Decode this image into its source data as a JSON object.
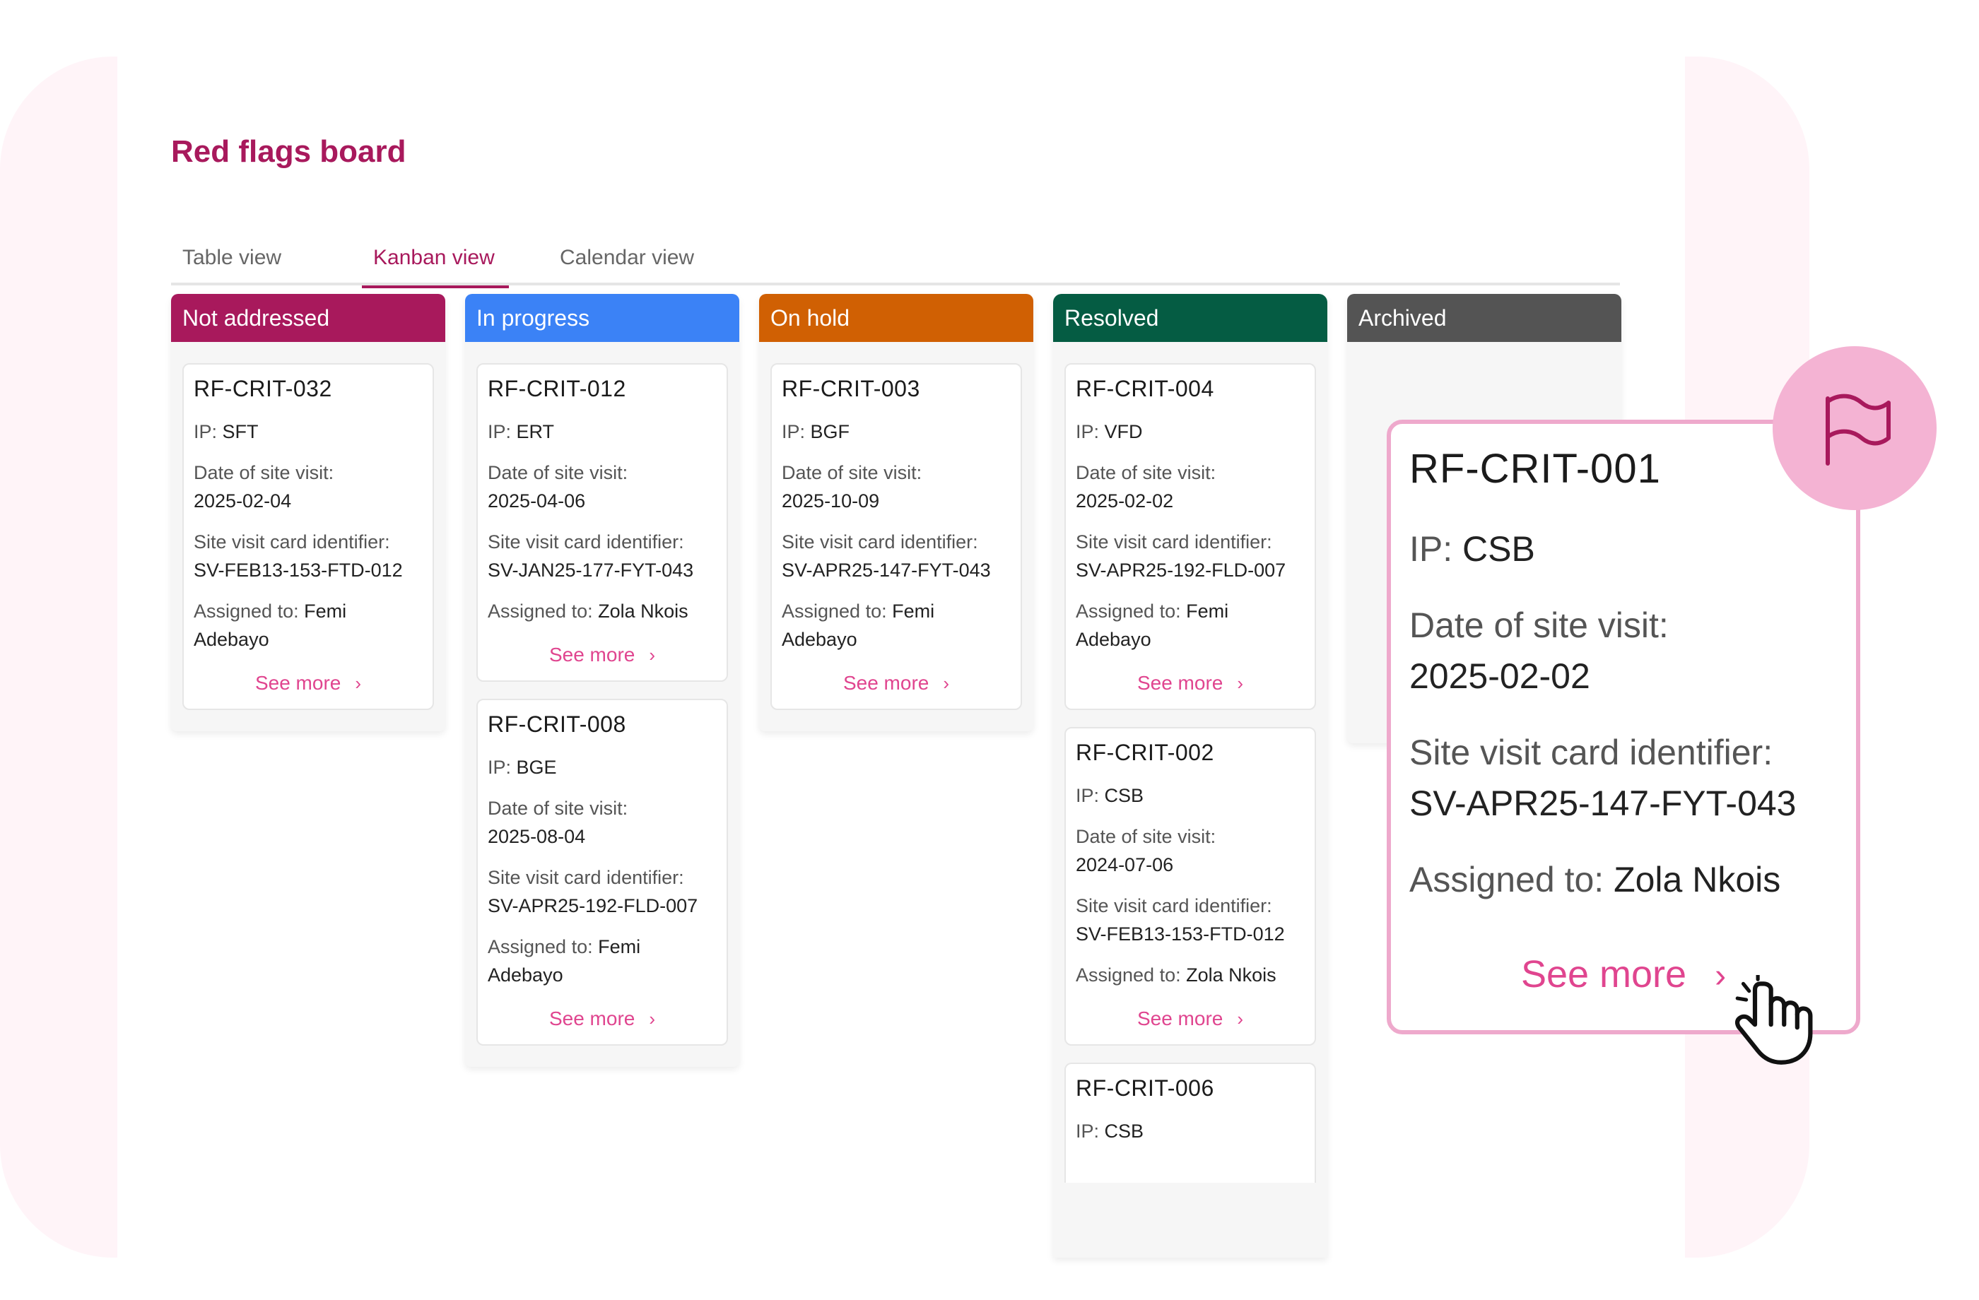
{
  "page_title": "Red flags board",
  "tabs": [
    {
      "label": "Table view",
      "active": false
    },
    {
      "label": "Kanban view",
      "active": true
    },
    {
      "label": "Calendar view",
      "active": false
    }
  ],
  "colors": {
    "brand": "#a8195c",
    "link": "#e0458f",
    "not_addressed": "#a8195c",
    "in_progress": "#3b82f6",
    "on_hold": "#d06003",
    "resolved": "#055c43",
    "archived": "#545454",
    "highlight_border": "#eea9cc",
    "badge": "#f4b3d3"
  },
  "labels": {
    "ip": "IP:",
    "date": "Date of site visit:",
    "identifier": "Site visit card identifier:",
    "assigned": "Assigned to:",
    "see_more": "See more",
    "chevron": "›"
  },
  "columns": [
    {
      "title": "Not addressed",
      "cards": [
        {
          "id": "RF-CRIT-032",
          "ip": "SFT",
          "date": "2025-02-04",
          "identifier": "SV-FEB13-153-FTD-012",
          "assigned": "Femi Adebayo"
        }
      ]
    },
    {
      "title": "In progress",
      "cards": [
        {
          "id": "RF-CRIT-012",
          "ip": "ERT",
          "date": "2025-04-06",
          "identifier": "SV-JAN25-177-FYT-043",
          "assigned": "Zola Nkois"
        },
        {
          "id": "RF-CRIT-008",
          "ip": "BGE",
          "date": "2025-08-04",
          "identifier": "SV-APR25-192-FLD-007",
          "assigned": "Femi Adebayo"
        }
      ]
    },
    {
      "title": "On hold",
      "cards": [
        {
          "id": "RF-CRIT-003",
          "ip": "BGF",
          "date": "2025-10-09",
          "identifier": "SV-APR25-147-FYT-043",
          "assigned": "Femi Adebayo"
        }
      ]
    },
    {
      "title": "Resolved",
      "cards": [
        {
          "id": "RF-CRIT-004",
          "ip": "VFD",
          "date": "2025-02-02",
          "identifier": "SV-APR25-192-FLD-007",
          "assigned": "Femi Adebayo"
        },
        {
          "id": "RF-CRIT-002",
          "ip": "CSB",
          "date": "2024-07-06",
          "identifier": "SV-FEB13-153-FTD-012",
          "assigned": "Zola Nkois"
        },
        {
          "id": "RF-CRIT-006",
          "ip": "CSB",
          "date": "",
          "identifier": "",
          "assigned": ""
        }
      ]
    },
    {
      "title": "Archived",
      "cards": []
    }
  ],
  "zoom_card": {
    "id": "RF-CRIT-001",
    "ip": "CSB",
    "date": "2025-02-02",
    "identifier": "SV-APR25-147-FYT-043",
    "assigned": "Zola Nkois"
  },
  "icons": {
    "badge": "flag-icon",
    "pointer": "hand-pointer-icon",
    "see_more": "chevron-right-icon"
  }
}
